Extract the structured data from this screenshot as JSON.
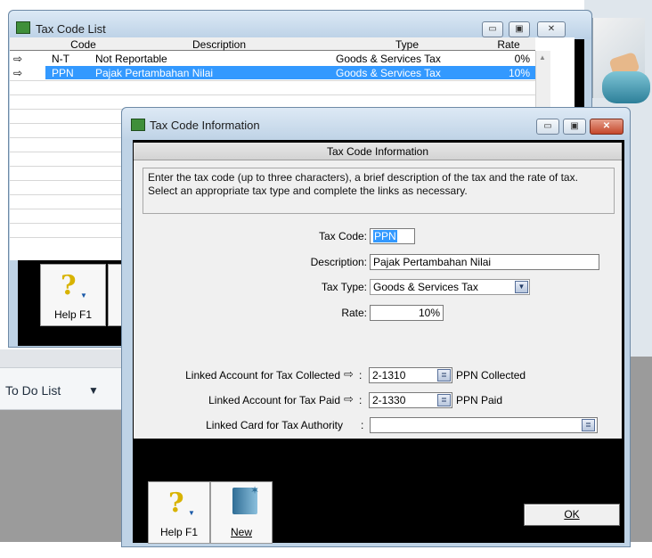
{
  "background": {
    "todo_list_label": "To Do List",
    "todo_arrow": "▼"
  },
  "list_window": {
    "title": "Tax Code List",
    "columns": [
      "Code",
      "Description",
      "Type",
      "Rate"
    ],
    "rows": [
      {
        "arrow": "⇨",
        "code": "N-T",
        "description": "Not Reportable",
        "type": "Goods & Services Tax",
        "rate": "0%",
        "selected": false
      },
      {
        "arrow": "⇨",
        "code": "PPN",
        "description": "Pajak Pertambahan Nilai",
        "type": "Goods & Services Tax",
        "rate": "10%",
        "selected": true
      }
    ],
    "help_label": "Help F1",
    "window_buttons": {
      "minimize": "▭",
      "maximize": "▣",
      "close": "✕"
    }
  },
  "info_window": {
    "title": "Tax Code Information",
    "panel_heading": "Tax Code Information",
    "instructions": "Enter the tax code (up to three characters), a brief description of the tax and the rate of tax. Select an appropriate tax type and complete the links as necessary.",
    "fields": {
      "tax_code_label": "Tax Code:",
      "tax_code_value": "PPN",
      "description_label": "Description:",
      "description_value": "Pajak Pertambahan Nilai",
      "tax_type_label": "Tax Type:",
      "tax_type_value": "Goods & Services Tax",
      "rate_label": "Rate:",
      "rate_value": "10%",
      "collected_label": "Linked Account for Tax Collected",
      "collected_account": "2-1310",
      "collected_name": "PPN Collected",
      "paid_label": "Linked Account for Tax Paid",
      "paid_account": "2-1330",
      "paid_name": "PPN Paid",
      "authority_label": "Linked Card for Tax Authority",
      "authority_sep": ":",
      "authority_value": "",
      "link_arrow": "⇨",
      "colon": ":"
    },
    "buttons": {
      "help_label": "Help F1",
      "new_label": "New",
      "ok_label": "OK"
    },
    "window_buttons": {
      "minimize": "▭",
      "maximize": "▣",
      "close": "✕"
    }
  },
  "colors": {
    "selection": "#3399ff",
    "window_frame": "#bfd3e6",
    "panel": "#f0f0f0"
  }
}
